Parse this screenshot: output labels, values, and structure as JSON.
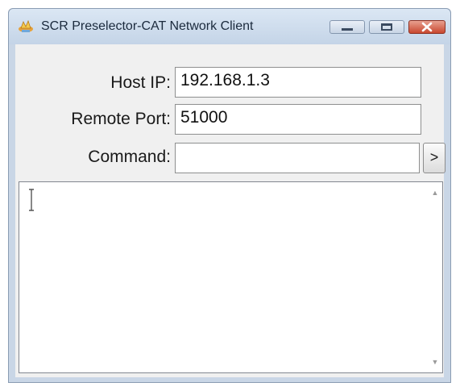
{
  "window": {
    "title": "SCR Preselector-CAT Network Client"
  },
  "form": {
    "host_ip_label": "Host IP:",
    "host_ip_value": "192.168.1.3",
    "remote_port_label": "Remote Port:",
    "remote_port_value": "51000",
    "command_label": "Command:",
    "command_value": "",
    "send_button_label": ">"
  },
  "output": {
    "text": ""
  },
  "colors": {
    "titlebar": "#c9d6e6",
    "close_button": "#c9482f",
    "client_bg": "#f0f0f0"
  },
  "icons": {
    "app": "app-icon",
    "minimize": "minimize-icon",
    "maximize": "maximize-icon",
    "close": "close-icon",
    "scroll_up": "scroll-up-icon",
    "scroll_down": "scroll-down-icon",
    "text_cursor": "text-cursor-icon"
  }
}
